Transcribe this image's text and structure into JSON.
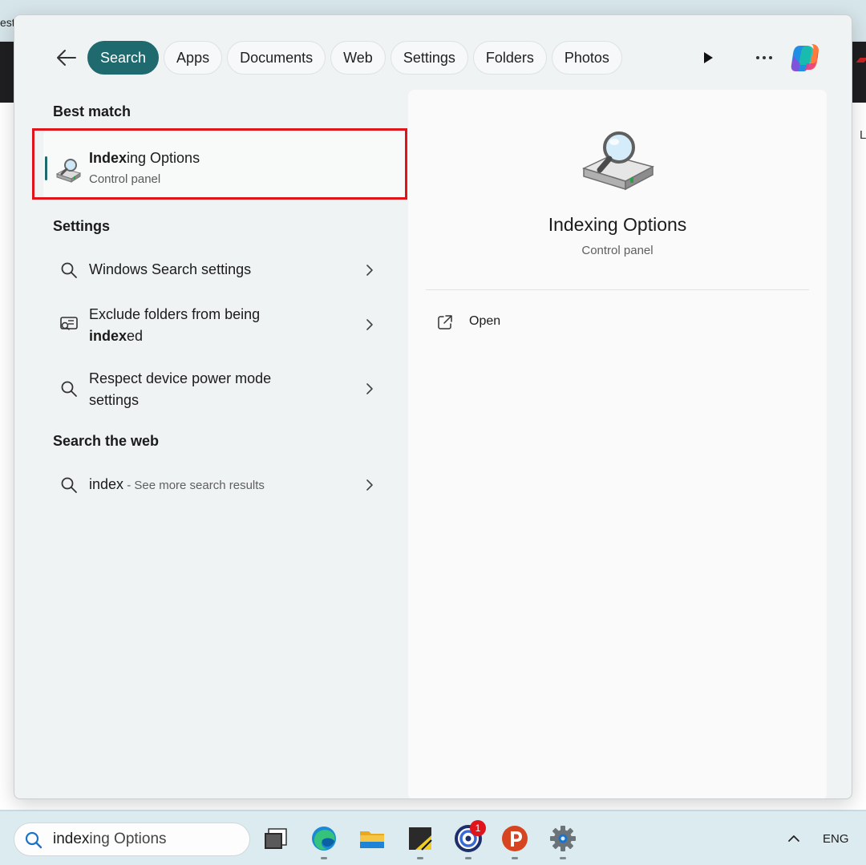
{
  "background": {
    "partial_text": "est"
  },
  "tabs": [
    {
      "label": "Search",
      "active": true
    },
    {
      "label": "Apps"
    },
    {
      "label": "Documents"
    },
    {
      "label": "Web"
    },
    {
      "label": "Settings"
    },
    {
      "label": "Folders"
    },
    {
      "label": "Photos"
    }
  ],
  "sections": {
    "best_match": "Best match",
    "settings": "Settings",
    "search_web": "Search the web"
  },
  "best_match": {
    "title_bold": "Index",
    "title_rest": "ing Options",
    "subtitle": "Control panel"
  },
  "settings_items": [
    {
      "text": "Windows Search settings"
    },
    {
      "text_line1": "Exclude folders from being",
      "text_bold": "index",
      "text_rest": "ed"
    },
    {
      "text": "Respect device power mode settings"
    }
  ],
  "web_item": {
    "query": "index",
    "more": " - See more search results"
  },
  "preview": {
    "title": "Indexing Options",
    "subtitle": "Control panel",
    "open_label": "Open"
  },
  "taskbar": {
    "search_bold": "index",
    "search_rest": "ing Options",
    "badge_count": "1",
    "language": "ENG"
  },
  "colors": {
    "accent": "#1f6a6f",
    "highlight": "#e0141b"
  }
}
